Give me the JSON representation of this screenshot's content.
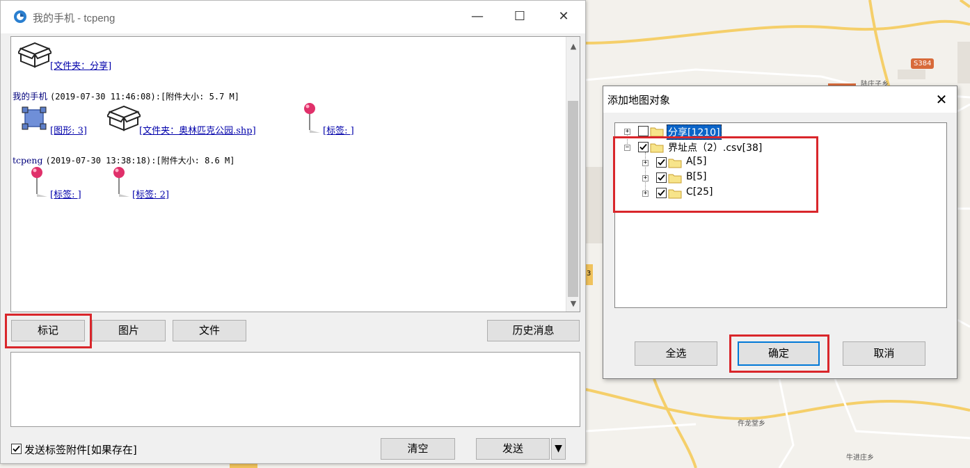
{
  "map": {
    "labels": [
      "S384",
      "陆庄子乡",
      "3",
      "3",
      "仵龙堂乡",
      "牛进庄乡"
    ]
  },
  "chat_window": {
    "title": "我的手机 - tcpeng",
    "controls": {
      "minimize": "—",
      "maximize": "☐",
      "close": "✕"
    },
    "messages": [
      {
        "attachments": [
          {
            "type": "folder",
            "label": "[文件夹：分享]"
          }
        ]
      },
      {
        "sender": "我的手机",
        "timestamp": "(2019-07-30 11:46:08)",
        "size": ":[附件大小: 5.7 M]",
        "attachments": [
          {
            "type": "shape",
            "label": "[图形: 3]"
          },
          {
            "type": "folder",
            "label": "[文件夹：奥林匹克公园.shp]"
          },
          {
            "type": "pin",
            "label": "[标签: ]"
          }
        ]
      },
      {
        "sender": "tcpeng",
        "timestamp": "(2019-07-30 13:38:18)",
        "size": ":[附件大小: 8.6 M]",
        "attachments": [
          {
            "type": "pin",
            "label": "[标签: ]"
          },
          {
            "type": "pin",
            "label": "[标签: 2]"
          }
        ]
      }
    ],
    "toolbar": {
      "mark_label": "标记",
      "image_label": "图片",
      "file_label": "文件",
      "history_label": "历史消息"
    },
    "input_value": "",
    "send_tag_attachment": {
      "label": "发送标签附件[如果存在]",
      "checked": true
    },
    "clear_label": "清空",
    "send_label": "发送",
    "send_menu_label": "▼"
  },
  "dialog": {
    "title": "添加地图对象",
    "close": "✕",
    "tree": [
      {
        "label": "分享[1210]",
        "checked": false,
        "selected": true,
        "level": 0,
        "expander": "+"
      },
      {
        "label": "界址点（2）.csv[38]",
        "checked": true,
        "selected": false,
        "level": 0,
        "expander": "−"
      },
      {
        "label": "A[5]",
        "checked": true,
        "selected": false,
        "level": 1,
        "expander": "+"
      },
      {
        "label": "B[5]",
        "checked": true,
        "selected": false,
        "level": 1,
        "expander": "+"
      },
      {
        "label": "C[25]",
        "checked": true,
        "selected": false,
        "level": 1,
        "expander": "+"
      }
    ],
    "select_all_label": "全选",
    "ok_label": "确定",
    "cancel_label": "取消"
  },
  "colors": {
    "highlight_red": "#d9262b",
    "link_blue": "#0000aa",
    "selection_blue": "#0a64c8",
    "default_button_border": "#0078d7"
  }
}
